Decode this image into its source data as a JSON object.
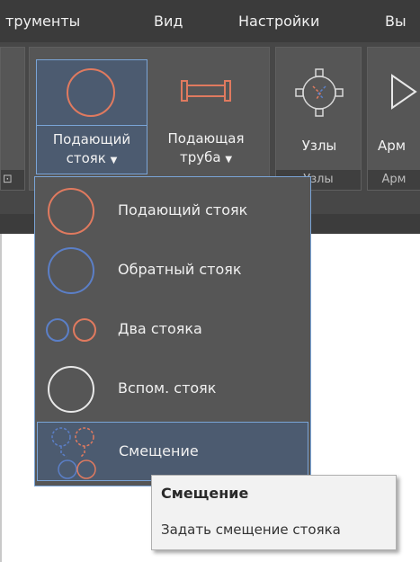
{
  "menubar": {
    "items": [
      "трументы",
      "Вид",
      "Настройки",
      "Вы"
    ]
  },
  "ribbon": {
    "feed_riser_label_1": "Подающий",
    "feed_riser_label_2": "стояк",
    "feed_pipe_label_1": "Подающая",
    "feed_pipe_label_2": "труба",
    "nodes_label": "Узлы",
    "fittings_label": "Арм",
    "panel_nodes_title": "Узлы",
    "panel_fittings_title": "Арм"
  },
  "dropdown": {
    "items": [
      {
        "label": "Подающий стояк",
        "icon": "red-circle-icon"
      },
      {
        "label": "Обратный стояк",
        "icon": "blue-circle-icon"
      },
      {
        "label": "Два стояка",
        "icon": "two-circles-icon"
      },
      {
        "label": "Вспом. стояк",
        "icon": "white-circle-icon"
      },
      {
        "label": "Смещение",
        "icon": "offset-icon",
        "selected": true
      }
    ]
  },
  "tooltip": {
    "title": "Смещение",
    "description": "Задать смещение стояка"
  },
  "colors": {
    "red": "#e07a5f",
    "blue": "#5b7fc7",
    "highlight_border": "#7aa4d6"
  }
}
